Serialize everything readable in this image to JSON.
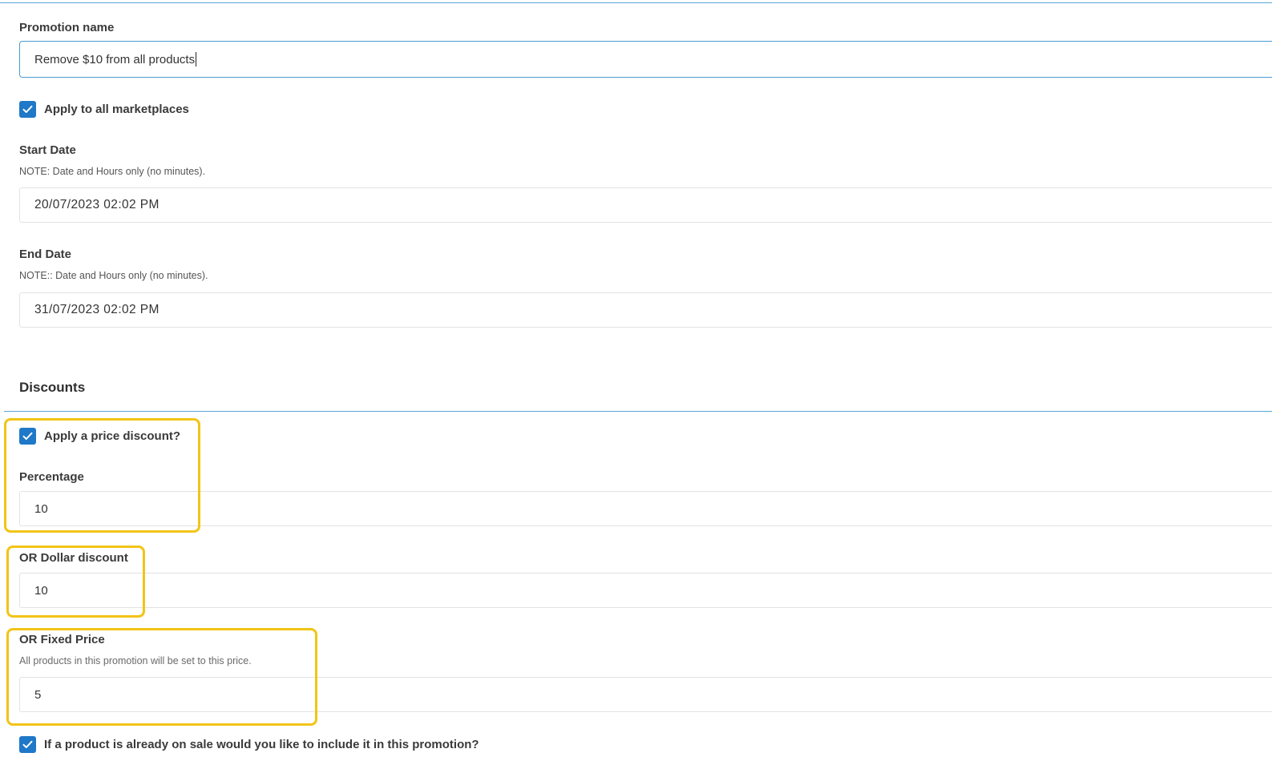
{
  "promotion": {
    "name_label": "Promotion name",
    "name_value": "Remove $10 from all products"
  },
  "marketplaces": {
    "label": "Apply to all marketplaces",
    "checked": true
  },
  "start_date": {
    "label": "Start Date",
    "note": "NOTE: Date and Hours only (no minutes).",
    "value": "20/07/2023 02:02 PM"
  },
  "end_date": {
    "label": "End Date",
    "note": "NOTE:: Date and Hours only (no minutes).",
    "value": "31/07/2023 02:02 PM"
  },
  "discounts": {
    "title": "Discounts",
    "price_discount": {
      "label": "Apply a price discount?",
      "checked": true
    },
    "percentage": {
      "label": "Percentage",
      "value": "10"
    },
    "dollar": {
      "label": "OR Dollar discount",
      "value": "10"
    },
    "fixed_price": {
      "label": "OR Fixed Price",
      "note": "All products in this promotion will be set to this price.",
      "value": "5"
    },
    "include_on_sale": {
      "label": "If a product is already on sale would you like to include it in this promotion?",
      "checked": true
    }
  },
  "colors": {
    "accent": "#1f78c8",
    "rule": "#5aa6d6",
    "highlight": "#f2c417"
  }
}
